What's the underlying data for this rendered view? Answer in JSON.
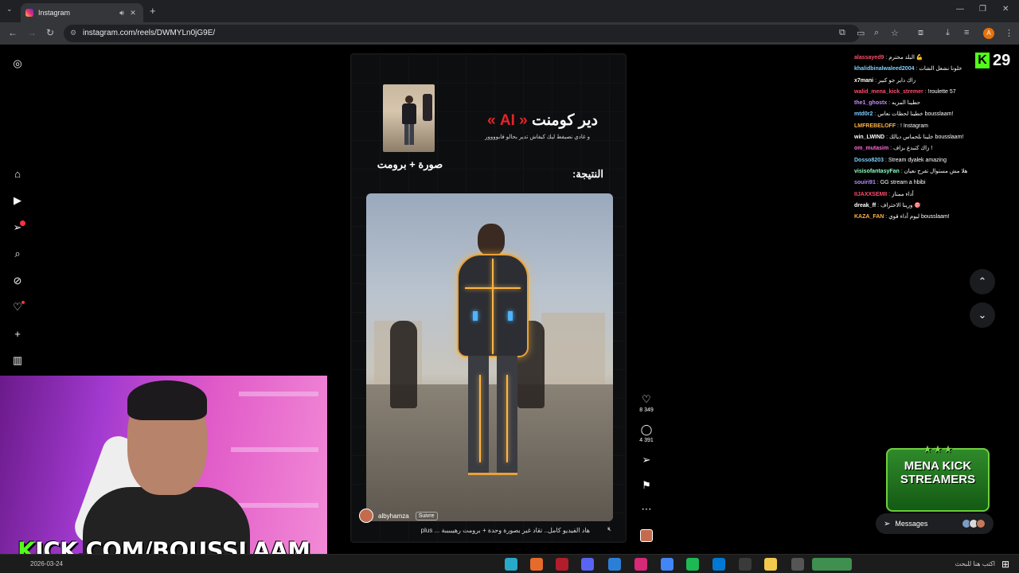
{
  "browser": {
    "tab_title": "Instagram",
    "tab_audio_icon": "speaker-icon",
    "tab_close": "✕",
    "new_tab": "+",
    "url": "instagram.com/reels/DWMYLn0jG9E/",
    "window_controls": [
      "—",
      "❐",
      "✕"
    ]
  },
  "reel": {
    "photo_caption": "صورة + برومت",
    "headline_main": "دير كومنت",
    "headline_ai": "« AI »",
    "subline": "و غادي نصيفط ليك كيفاش تدير بحالو فابوووور",
    "result_label": ":النتيجة",
    "author": "albyhamza",
    "follow_label": "Suivre",
    "caption": "هاد الفيديو كامل.. تقاد غير بصورة وحدة + برومت رهيببببة ... plus"
  },
  "actions": {
    "likes": "8 349",
    "comments": "4 391"
  },
  "chat": [
    {
      "user": "alassayed9",
      "color": "#ff4d6d",
      "msg": "البلد محترم 💪"
    },
    {
      "user": "khalidbinalwaleed2004",
      "color": "#7fd0ff",
      "msg": "خلونا نشعل الشات"
    },
    {
      "user": "x7mani",
      "color": "#ffffff",
      "msg": "زاك داير جو كبير"
    },
    {
      "user": "walid_mena_kick_stremer",
      "color": "#ff4d6d",
      "msg": "!roulette 57"
    },
    {
      "user": "the1_ghostx",
      "color": "#c98bff",
      "msg": "حطينا المزيه"
    },
    {
      "user": "mtd0r2",
      "color": "#7fd0ff",
      "msg": "خطينا لحظات نعاس bousslaam!"
    },
    {
      "user": "LMFREBELOFF",
      "color": "#ffb347",
      "msg": "! Instagram"
    },
    {
      "user": "win_LWIND",
      "color": "#ffffff",
      "msg": "خلينا نلحماس ديالك bousslaam!"
    },
    {
      "user": "om_mutasim",
      "color": "#ff6bd6",
      "msg": "زاك كتبدع بزاف !"
    },
    {
      "user": "Dosso8203",
      "color": "#7fd0ff",
      "msg": "Stream dyalek amazing"
    },
    {
      "user": "visisofantasyFan",
      "color": "#8affc1",
      "msg": "هلا مش مستوال تفرج نعيان"
    },
    {
      "user": "souiri91",
      "color": "#b58bff",
      "msg": "GG stream a hbibi"
    },
    {
      "user": "IIJAXXSEMII",
      "color": "#ff4d6d",
      "msg": "أداء ممتاز"
    },
    {
      "user": "dreak_ff",
      "color": "#ffffff",
      "msg": "ورينا الاحتراف 🎯"
    },
    {
      "user": "KAZA_FAN",
      "color": "#ffb347",
      "msg": "ليوم أداء قوي bousslaam!"
    }
  ],
  "viewers": "29",
  "overlay": {
    "kick_url_k": "K",
    "kick_url_rest": "ICK.COM/BOUSSLAAM",
    "badge_line1": "MENA KICK",
    "badge_line2": "STREAMERS",
    "badge_stars": "★ ★ ★"
  },
  "messages_label": "Messages",
  "taskbar": {
    "date": "2026-03-24",
    "search_placeholder": "اكتب هنا للبحث"
  }
}
